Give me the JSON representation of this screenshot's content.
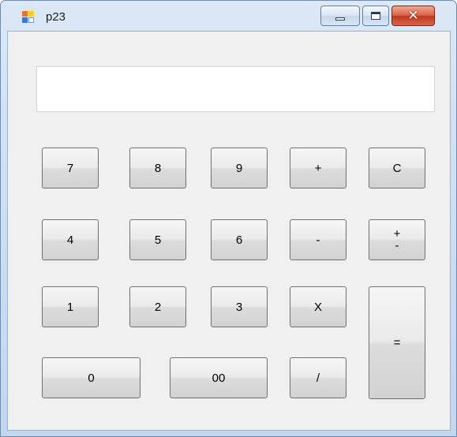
{
  "window": {
    "title": "p23",
    "icon": "app-icon",
    "controls": {
      "minimize": "minimize-icon",
      "maximize": "maximize-icon",
      "close": "close-icon"
    }
  },
  "display": {
    "value": ""
  },
  "buttons": {
    "seven": "7",
    "eight": "8",
    "nine": "9",
    "plus": "+",
    "clear": "C",
    "four": "4",
    "five": "5",
    "six": "6",
    "minus": "-",
    "plus_minus_top": "+",
    "plus_minus_bottom": "-",
    "one": "1",
    "two": "2",
    "three": "3",
    "multiply": "X",
    "equals": "=",
    "zero": "0",
    "double_zero": "00",
    "divide": "/"
  }
}
